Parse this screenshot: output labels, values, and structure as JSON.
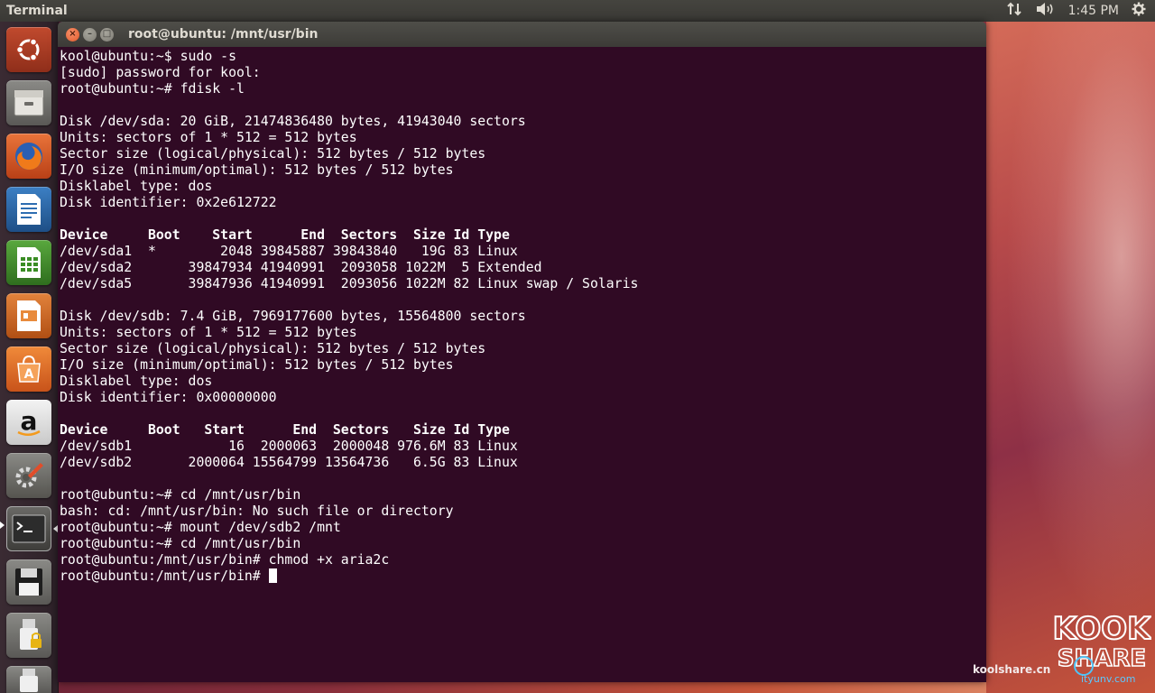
{
  "top_panel": {
    "app_title": "Terminal",
    "network_icon": "network-updown-icon",
    "sound_icon": "volume-icon",
    "time": "1:45 PM",
    "settings_icon": "gear-icon"
  },
  "launcher": {
    "items": [
      {
        "name": "ubuntu-dash-icon"
      },
      {
        "name": "files-icon"
      },
      {
        "name": "firefox-icon"
      },
      {
        "name": "libreoffice-writer-icon"
      },
      {
        "name": "libreoffice-calc-icon"
      },
      {
        "name": "libreoffice-impress-icon"
      },
      {
        "name": "software-center-icon"
      },
      {
        "name": "amazon-icon"
      },
      {
        "name": "system-settings-icon"
      },
      {
        "name": "terminal-icon"
      },
      {
        "name": "save-disk-icon"
      },
      {
        "name": "usb-drive-icon"
      }
    ]
  },
  "window": {
    "title": "root@ubuntu: /mnt/usr/bin",
    "close_glyph": "×",
    "min_glyph": "–",
    "max_glyph": "□"
  },
  "terminal": {
    "lines": [
      "kool@ubuntu:~$ sudo -s",
      "[sudo] password for kool:",
      "root@ubuntu:~# fdisk -l",
      "",
      "Disk /dev/sda: 20 GiB, 21474836480 bytes, 41943040 sectors",
      "Units: sectors of 1 * 512 = 512 bytes",
      "Sector size (logical/physical): 512 bytes / 512 bytes",
      "I/O size (minimum/optimal): 512 bytes / 512 bytes",
      "Disklabel type: dos",
      "Disk identifier: 0x2e612722",
      "",
      "Device     Boot    Start      End  Sectors  Size Id Type",
      "/dev/sda1  *        2048 39845887 39843840   19G 83 Linux",
      "/dev/sda2       39847934 41940991  2093058 1022M  5 Extended",
      "/dev/sda5       39847936 41940991  2093056 1022M 82 Linux swap / Solaris",
      "",
      "Disk /dev/sdb: 7.4 GiB, 7969177600 bytes, 15564800 sectors",
      "Units: sectors of 1 * 512 = 512 bytes",
      "Sector size (logical/physical): 512 bytes / 512 bytes",
      "I/O size (minimum/optimal): 512 bytes / 512 bytes",
      "Disklabel type: dos",
      "Disk identifier: 0x00000000",
      "",
      "Device     Boot   Start      End  Sectors   Size Id Type",
      "/dev/sdb1            16  2000063  2000048 976.6M 83 Linux",
      "/dev/sdb2       2000064 15564799 13564736   6.5G 83 Linux",
      "",
      "root@ubuntu:~# cd /mnt/usr/bin",
      "bash: cd: /mnt/usr/bin: No such file or directory",
      "root@ubuntu:~# mount /dev/sdb2 /mnt",
      "root@ubuntu:~# cd /mnt/usr/bin",
      "root@ubuntu:/mnt/usr/bin# chmod +x aria2c",
      "root@ubuntu:/mnt/usr/bin# "
    ],
    "bold_lines": [
      11,
      23
    ],
    "background": "#300a24",
    "foreground": "#ffffff"
  },
  "watermark": {
    "site": "koolshare.cn",
    "logo_text_top": "KOOK",
    "logo_text_bottom": "SHARE",
    "site2": "ityunv.com"
  }
}
